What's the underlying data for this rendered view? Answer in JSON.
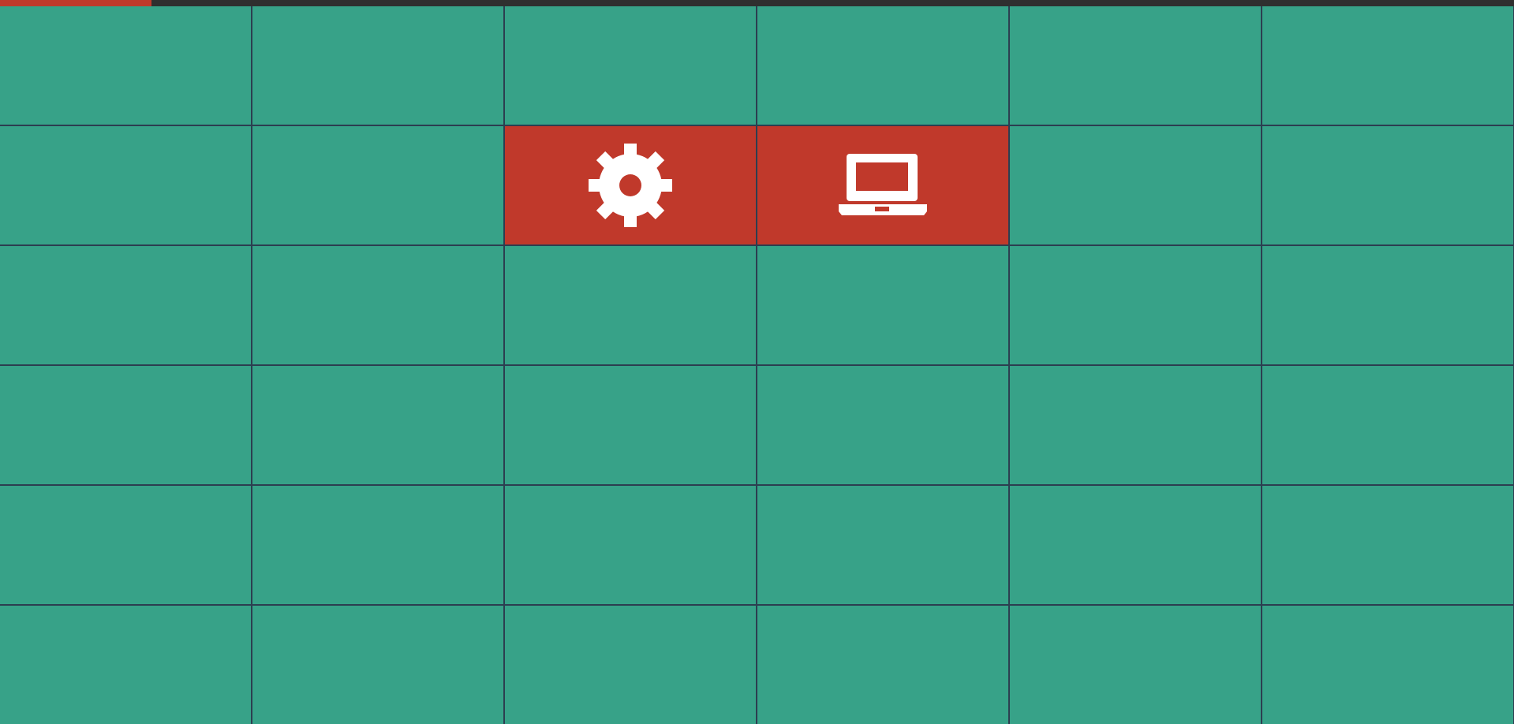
{
  "game": {
    "progress": 0.1,
    "grid": {
      "columns": 6,
      "rows": 6
    },
    "colors": {
      "tile_hidden": "#37a288",
      "tile_revealed": "#c0392b",
      "grid_line": "#2c3e50",
      "progress_track": "#2f2f2f",
      "progress_fill": "#c0392b"
    },
    "tiles": [
      {
        "row": 0,
        "col": 0,
        "state": "hidden",
        "icon": ""
      },
      {
        "row": 0,
        "col": 1,
        "state": "hidden",
        "icon": ""
      },
      {
        "row": 0,
        "col": 2,
        "state": "hidden",
        "icon": ""
      },
      {
        "row": 0,
        "col": 3,
        "state": "hidden",
        "icon": ""
      },
      {
        "row": 0,
        "col": 4,
        "state": "hidden",
        "icon": ""
      },
      {
        "row": 0,
        "col": 5,
        "state": "hidden",
        "icon": ""
      },
      {
        "row": 1,
        "col": 0,
        "state": "hidden",
        "icon": ""
      },
      {
        "row": 1,
        "col": 1,
        "state": "hidden",
        "icon": ""
      },
      {
        "row": 1,
        "col": 2,
        "state": "revealed",
        "icon": "gear-icon"
      },
      {
        "row": 1,
        "col": 3,
        "state": "revealed",
        "icon": "laptop-icon"
      },
      {
        "row": 1,
        "col": 4,
        "state": "hidden",
        "icon": ""
      },
      {
        "row": 1,
        "col": 5,
        "state": "hidden",
        "icon": ""
      },
      {
        "row": 2,
        "col": 0,
        "state": "hidden",
        "icon": ""
      },
      {
        "row": 2,
        "col": 1,
        "state": "hidden",
        "icon": ""
      },
      {
        "row": 2,
        "col": 2,
        "state": "hidden",
        "icon": ""
      },
      {
        "row": 2,
        "col": 3,
        "state": "hidden",
        "icon": ""
      },
      {
        "row": 2,
        "col": 4,
        "state": "hidden",
        "icon": ""
      },
      {
        "row": 2,
        "col": 5,
        "state": "hidden",
        "icon": ""
      },
      {
        "row": 3,
        "col": 0,
        "state": "hidden",
        "icon": ""
      },
      {
        "row": 3,
        "col": 1,
        "state": "hidden",
        "icon": ""
      },
      {
        "row": 3,
        "col": 2,
        "state": "hidden",
        "icon": ""
      },
      {
        "row": 3,
        "col": 3,
        "state": "hidden",
        "icon": ""
      },
      {
        "row": 3,
        "col": 4,
        "state": "hidden",
        "icon": ""
      },
      {
        "row": 3,
        "col": 5,
        "state": "hidden",
        "icon": ""
      },
      {
        "row": 4,
        "col": 0,
        "state": "hidden",
        "icon": ""
      },
      {
        "row": 4,
        "col": 1,
        "state": "hidden",
        "icon": ""
      },
      {
        "row": 4,
        "col": 2,
        "state": "hidden",
        "icon": ""
      },
      {
        "row": 4,
        "col": 3,
        "state": "hidden",
        "icon": ""
      },
      {
        "row": 4,
        "col": 4,
        "state": "hidden",
        "icon": ""
      },
      {
        "row": 4,
        "col": 5,
        "state": "hidden",
        "icon": ""
      },
      {
        "row": 5,
        "col": 0,
        "state": "hidden",
        "icon": ""
      },
      {
        "row": 5,
        "col": 1,
        "state": "hidden",
        "icon": ""
      },
      {
        "row": 5,
        "col": 2,
        "state": "hidden",
        "icon": ""
      },
      {
        "row": 5,
        "col": 3,
        "state": "hidden",
        "icon": ""
      },
      {
        "row": 5,
        "col": 4,
        "state": "hidden",
        "icon": ""
      },
      {
        "row": 5,
        "col": 5,
        "state": "hidden",
        "icon": ""
      }
    ]
  }
}
